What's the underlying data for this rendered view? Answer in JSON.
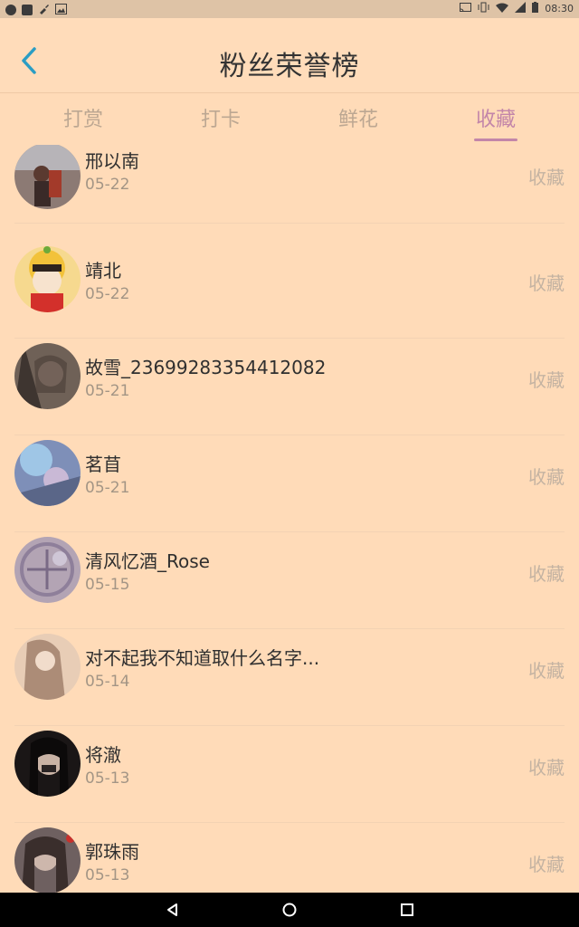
{
  "status_bar": {
    "time": "08:30",
    "left_icons": [
      "chat-notification-icon",
      "square-notification-icon",
      "broom-icon",
      "image-icon"
    ],
    "right_icons": [
      "cast-icon",
      "vibrate-icon",
      "wifi-icon",
      "signal-icon",
      "battery-icon"
    ]
  },
  "header": {
    "title": "粉丝荣誉榜",
    "back_icon": "chevron-left-icon"
  },
  "tabs": [
    {
      "label": "打赏",
      "active": false
    },
    {
      "label": "打卡",
      "active": false
    },
    {
      "label": "鲜花",
      "active": false
    },
    {
      "label": "收藏",
      "active": true
    }
  ],
  "list": {
    "items": [
      {
        "name": "邢以南",
        "date": "05-22",
        "action": "收藏"
      },
      {
        "name": "靖北",
        "date": "05-22",
        "action": "收藏"
      },
      {
        "name": "故雪_23699283354412082",
        "date": "05-21",
        "action": "收藏"
      },
      {
        "name": "茗苜",
        "date": "05-21",
        "action": "收藏"
      },
      {
        "name": "清风忆酒_Rose",
        "date": "05-15",
        "action": "收藏"
      },
      {
        "name": "对不起我不知道取什么名字...",
        "date": "05-14",
        "action": "收藏"
      },
      {
        "name": "将澈",
        "date": "05-13",
        "action": "收藏"
      },
      {
        "name": "郭珠雨",
        "date": "05-13",
        "action": "收藏"
      }
    ]
  },
  "nav_bar": {
    "back": "triangle-back-icon",
    "home": "circle-home-icon",
    "recents": "square-recents-icon"
  },
  "colors": {
    "background": "#FFDBB8",
    "active_tab": "#C386A9",
    "back_arrow": "#2A9DC4"
  }
}
